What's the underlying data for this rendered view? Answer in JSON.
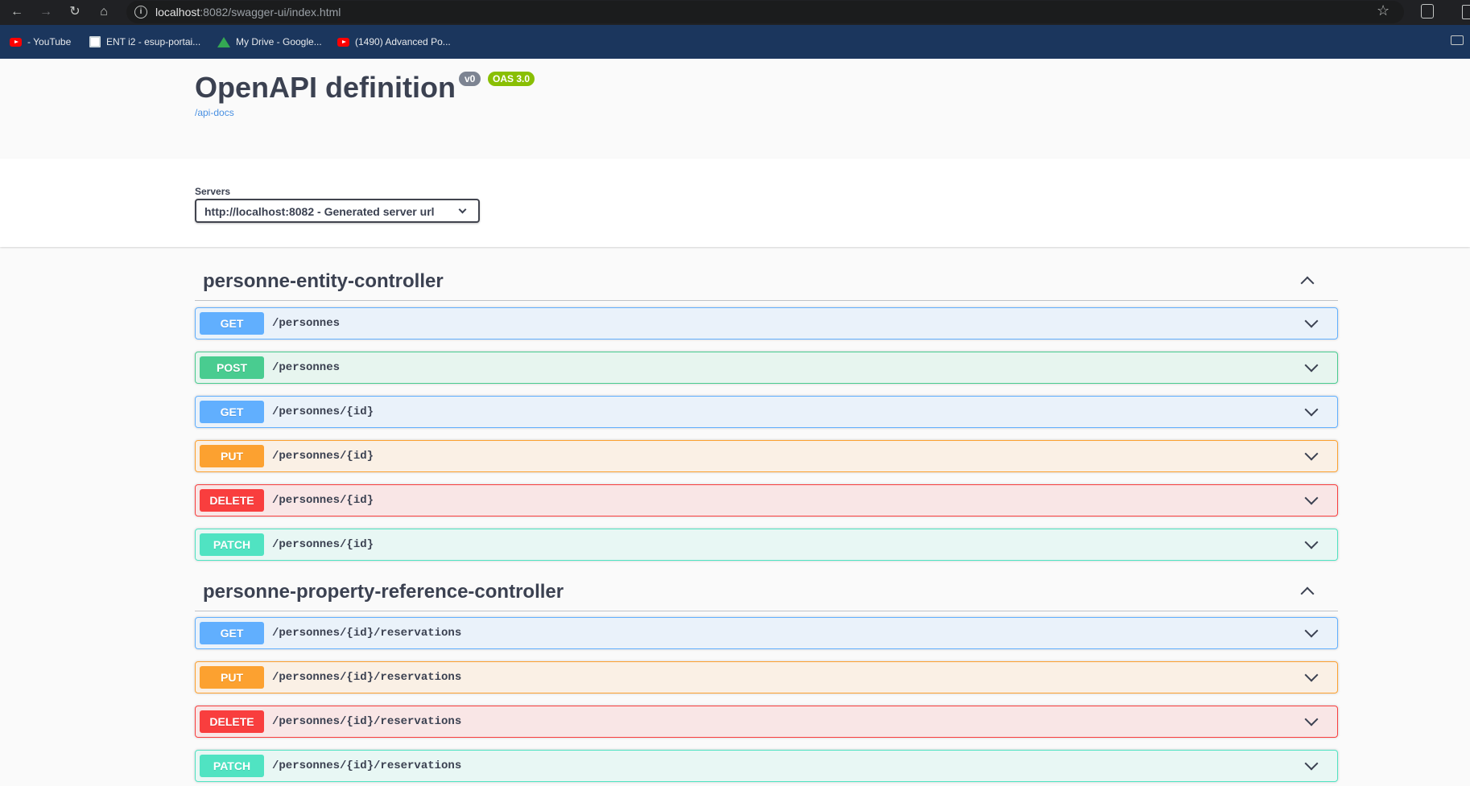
{
  "browser": {
    "url_host": "localhost",
    "url_rest": ":8082/swagger-ui/index.html",
    "bookmarks": [
      {
        "label": "- YouTube",
        "icon": "youtube-icon"
      },
      {
        "label": "ENT i2 - esup-portai...",
        "icon": "ent-icon"
      },
      {
        "label": "My Drive - Google...",
        "icon": "drive-icon"
      },
      {
        "label": "(1490) Advanced Po...",
        "icon": "youtube-icon"
      }
    ]
  },
  "info": {
    "title": "OpenAPI definition",
    "version": "v0",
    "oas": "OAS 3.0",
    "docs_link": "/api-docs"
  },
  "servers": {
    "label": "Servers",
    "selected": "http://localhost:8082 - Generated server url"
  },
  "tags": [
    {
      "name": "personne-entity-controller",
      "operations": [
        {
          "method": "GET",
          "path": "/personnes"
        },
        {
          "method": "POST",
          "path": "/personnes"
        },
        {
          "method": "GET",
          "path": "/personnes/{id}"
        },
        {
          "method": "PUT",
          "path": "/personnes/{id}"
        },
        {
          "method": "DELETE",
          "path": "/personnes/{id}"
        },
        {
          "method": "PATCH",
          "path": "/personnes/{id}"
        }
      ]
    },
    {
      "name": "personne-property-reference-controller",
      "operations": [
        {
          "method": "GET",
          "path": "/personnes/{id}/reservations"
        },
        {
          "method": "PUT",
          "path": "/personnes/{id}/reservations"
        },
        {
          "method": "DELETE",
          "path": "/personnes/{id}/reservations"
        },
        {
          "method": "PATCH",
          "path": "/personnes/{id}/reservations"
        }
      ]
    }
  ],
  "colors": {
    "get": "#61affe",
    "post": "#49cc90",
    "put": "#fca130",
    "delete": "#f93e3e",
    "patch": "#50e3c2"
  }
}
